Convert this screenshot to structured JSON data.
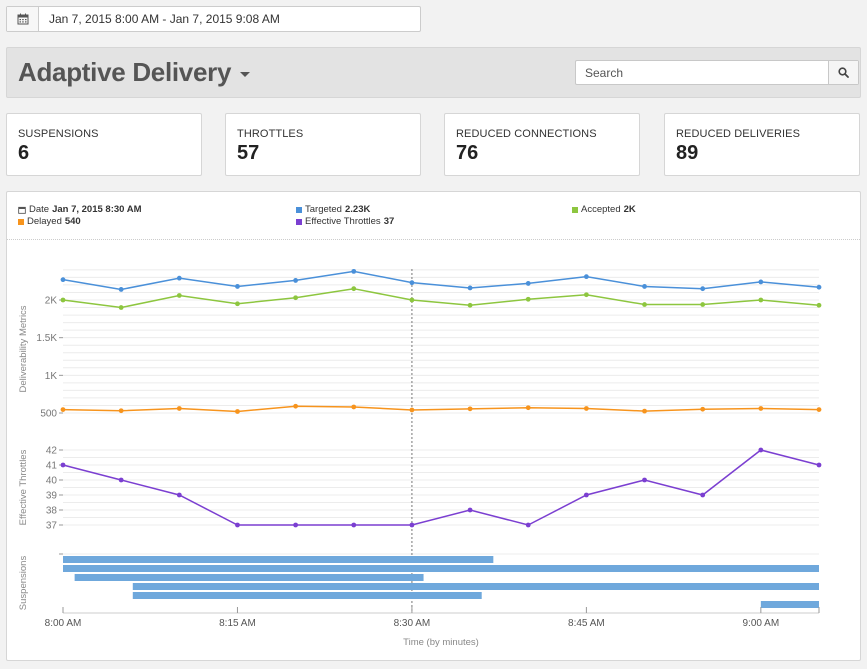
{
  "date_range": {
    "value": "Jan 7, 2015 8:00 AM - Jan 7, 2015 9:08 AM",
    "icon": "calendar-icon"
  },
  "header": {
    "title": "Adaptive Delivery",
    "dropdown_icon": "caret-down-icon"
  },
  "search": {
    "placeholder": "Search",
    "icon": "search-icon"
  },
  "stats": [
    {
      "label": "SUSPENSIONS",
      "value": "6"
    },
    {
      "label": "THROTTLES",
      "value": "57"
    },
    {
      "label": "REDUCED CONNECTIONS",
      "value": "76"
    },
    {
      "label": "REDUCED DELIVERIES",
      "value": "89"
    }
  ],
  "legend": {
    "date": {
      "label": "Date",
      "value": "Jan 7, 2015 8:30 AM"
    },
    "targeted": {
      "label": "Targeted",
      "value": "2.23K",
      "color": "#4a90d9"
    },
    "accepted": {
      "label": "Accepted",
      "value": "2K",
      "color": "#8dc63f"
    },
    "delayed": {
      "label": "Delayed",
      "value": "540",
      "color": "#f7941d"
    },
    "effective_throttles": {
      "label": "Effective Throttles",
      "value": "37",
      "color": "#7b3fd1"
    }
  },
  "chart_data": [
    {
      "type": "line",
      "ylabel": "Deliverability Metrics",
      "yticks": [
        "500",
        "1K",
        "1.5K",
        "2K"
      ],
      "x": [
        "8:00",
        "8:05",
        "8:10",
        "8:15",
        "8:20",
        "8:25",
        "8:30",
        "8:35",
        "8:40",
        "8:45",
        "8:50",
        "8:55",
        "9:00",
        "9:05"
      ],
      "series": [
        {
          "name": "Targeted",
          "color": "#4a90d9",
          "values": [
            2270,
            2140,
            2290,
            2180,
            2260,
            2380,
            2230,
            2160,
            2220,
            2310,
            2180,
            2150,
            2240,
            2170
          ]
        },
        {
          "name": "Accepted",
          "color": "#8dc63f",
          "values": [
            2000,
            1900,
            2060,
            1950,
            2030,
            2150,
            2000,
            1930,
            2010,
            2070,
            1940,
            1940,
            2000,
            1930
          ]
        },
        {
          "name": "Delayed",
          "color": "#f7941d",
          "values": [
            545,
            530,
            560,
            520,
            590,
            580,
            540,
            555,
            570,
            560,
            525,
            550,
            560,
            545
          ]
        }
      ]
    },
    {
      "type": "line",
      "ylabel": "Effective Throttles",
      "yticks": [
        "37",
        "38",
        "39",
        "40",
        "41",
        "42"
      ],
      "x": [
        "8:00",
        "8:05",
        "8:10",
        "8:15",
        "8:20",
        "8:25",
        "8:30",
        "8:35",
        "8:40",
        "8:45",
        "8:50",
        "8:55",
        "9:00",
        "9:05"
      ],
      "series": [
        {
          "name": "Effective Throttles",
          "color": "#7b3fd1",
          "values": [
            41,
            40,
            39,
            37,
            37,
            37,
            37,
            38,
            37,
            39,
            40,
            39,
            42,
            41
          ]
        }
      ]
    },
    {
      "type": "bar",
      "ylabel": "Suspensions",
      "color": "#6fa8dc",
      "bars": [
        {
          "start": "8:00",
          "end": "8:37"
        },
        {
          "start": "8:00",
          "end": "9:05"
        },
        {
          "start": "8:01",
          "end": "8:31"
        },
        {
          "start": "8:06",
          "end": "9:05"
        },
        {
          "start": "8:06",
          "end": "8:36"
        },
        {
          "start": "9:00",
          "end": "9:05"
        }
      ]
    }
  ],
  "x_axis": {
    "ticks": [
      "8:00 AM",
      "8:15 AM",
      "8:30 AM",
      "8:45 AM",
      "9:00 AM"
    ],
    "label": "Time (by minutes)",
    "cursor": "8:30"
  }
}
